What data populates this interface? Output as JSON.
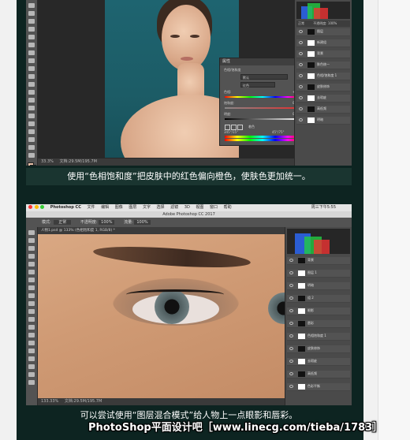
{
  "caption_1": "使用“色相饱和度”把皮肤中的红色偏向橙色，使肤色更加统一。",
  "caption_2": "可以尝试使用“图层混合模式”给人物上一点眼影和唇彩。",
  "watermark": "PhotoShop平面设计吧［www.linecg.com/tieba/1783］",
  "ss1": {
    "dialog_title": "属性",
    "dialog_sub": "色相/饱和度",
    "preset_value": "默认",
    "channel_value": "红色",
    "hue_label": "色相:",
    "hue_value": "+12",
    "saturation_label": "饱和度:",
    "saturation_value": "0",
    "lightness_label": "明度:",
    "lightness_value": "0",
    "colorize_label": "着色",
    "range_left": "345°/15°",
    "range_right": "45°/75°",
    "zoom_status": "33.3%",
    "doc_status": "文档:29.5M/195.7M",
    "blend_mode": "正常",
    "opacity_label": "不透明度:",
    "opacity_value": "100%",
    "layers": [
      {
        "name": "图层",
        "thumb": "dark"
      },
      {
        "name": "新建组",
        "thumb": "light"
      },
      {
        "name": "背景",
        "thumb": "light"
      },
      {
        "name": "肤色统一",
        "thumb": "dark"
      },
      {
        "name": "色相/饱和度 1",
        "thumb": "light"
      },
      {
        "name": "皮肤修饰",
        "thumb": "dark"
      },
      {
        "name": "去瑕疵",
        "thumb": "light"
      },
      {
        "name": "高低频",
        "thumb": "dark"
      },
      {
        "name": "明暗",
        "thumb": "light"
      }
    ]
  },
  "ss2": {
    "mac_menu": [
      "Photoshop CC",
      "文件",
      "编辑",
      "图像",
      "图层",
      "文字",
      "选择",
      "滤镜",
      "3D",
      "视图",
      "窗口",
      "帮助"
    ],
    "mac_right": "周三下午5:55",
    "app_title": "Adobe Photoshop CC 2017",
    "doc_tab": "人物1.psd @ 133% (色相饱和度 1, RGB/8) *",
    "zoom_status": "133.33%",
    "doc_status": "文档:29.5M/195.7M",
    "opt_mode": "模式:",
    "opt_mode_value": "正常",
    "opt_opacity": "不透明度:",
    "opt_opacity_value": "100%",
    "opt_flow": "流量:",
    "opt_flow_value": "100%",
    "layers": [
      {
        "name": "背景",
        "thumb": "dark"
      },
      {
        "name": "图层 1",
        "thumb": "light"
      },
      {
        "name": "明暗",
        "thumb": "light"
      },
      {
        "name": "组 2",
        "thumb": "dark"
      },
      {
        "name": "眼影",
        "thumb": "light"
      },
      {
        "name": "唇彩",
        "thumb": "dark"
      },
      {
        "name": "色相饱和度 1",
        "thumb": "light"
      },
      {
        "name": "皮肤修饰",
        "thumb": "dark"
      },
      {
        "name": "去瑕疵",
        "thumb": "light"
      },
      {
        "name": "高低频",
        "thumb": "dark"
      },
      {
        "name": "色彩平衡",
        "thumb": "light"
      }
    ]
  }
}
